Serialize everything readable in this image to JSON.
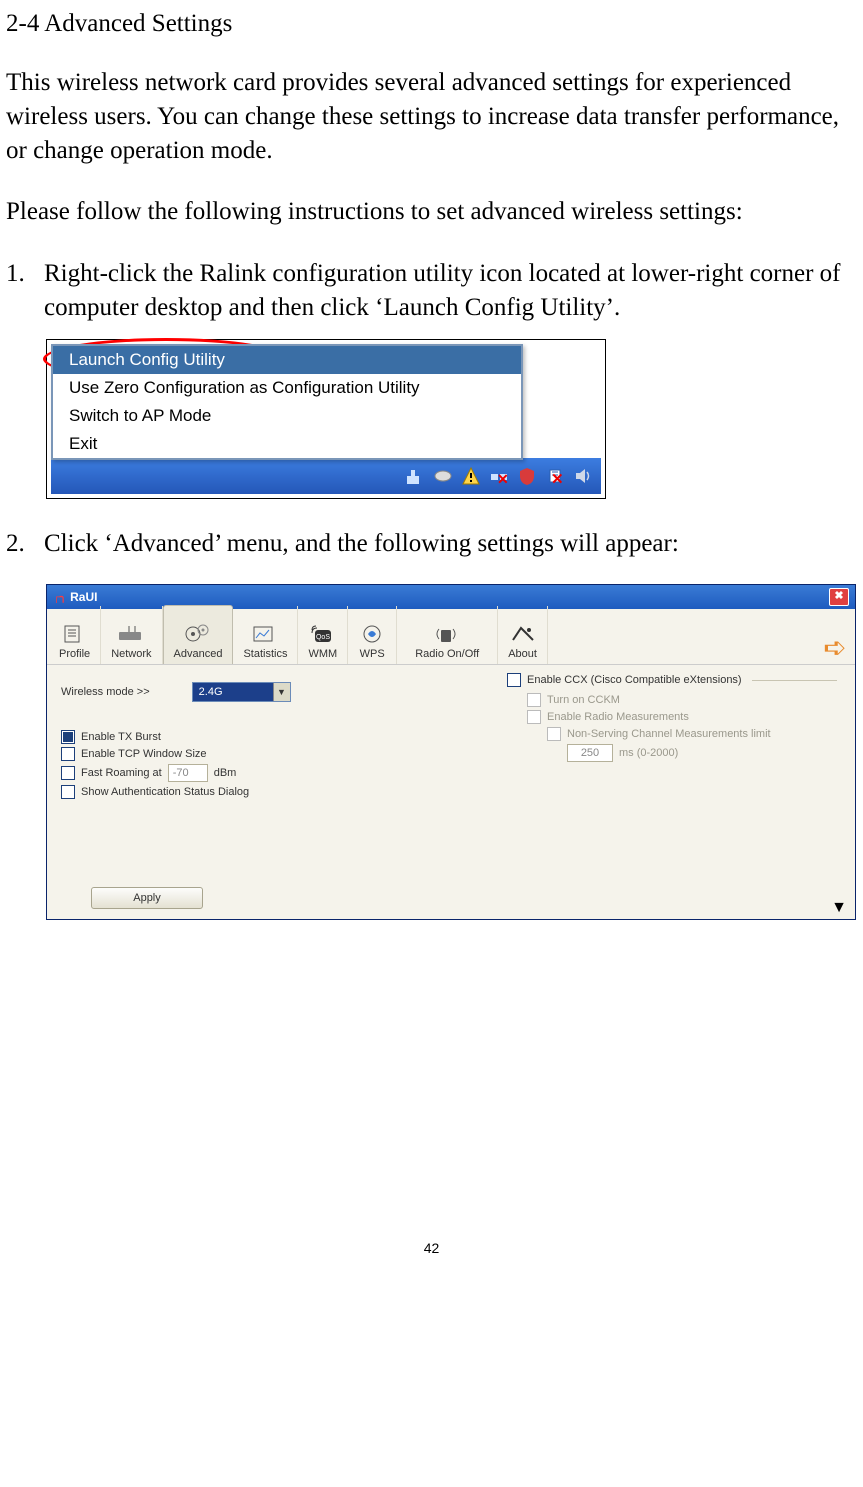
{
  "heading": "2-4 Advanced Settings",
  "para1": "This wireless network card provides several advanced settings for experienced wireless users. You can change these settings to increase data transfer performance, or change operation mode.",
  "para2": "Please follow the following instructions to set advanced wireless settings:",
  "steps": {
    "s1_num": "1.",
    "s1_text": "Right-click the Ralink configuration utility icon located at lower-right corner of computer desktop and then click ‘Launch Config Utility’.",
    "s2_num": "2.",
    "s2_text": "Click ‘Advanced’ menu, and the following settings will appear:"
  },
  "context_menu": {
    "items": [
      "Launch Config Utility",
      "Use Zero Configuration as Configuration Utility",
      "Switch to AP Mode",
      "Exit"
    ]
  },
  "raui": {
    "title": "RaUI",
    "close_glyph": "✖",
    "tabs": [
      "Profile",
      "Network",
      "Advanced",
      "Statistics",
      "WMM",
      "WPS",
      "Radio On/Off",
      "About"
    ],
    "wireless_mode_label": "Wireless mode >>",
    "wireless_mode_value": "2.4G",
    "left_checks": [
      {
        "label": "Enable TX Burst",
        "checked": true
      },
      {
        "label": "Enable TCP Window Size",
        "checked": false
      },
      {
        "label": "Fast Roaming at",
        "checked": false
      },
      {
        "label": "Show Authentication Status Dialog",
        "checked": false
      }
    ],
    "fast_roaming_value": "-70",
    "fast_roaming_unit": "dBm",
    "ccx_header": "Enable CCX (Cisco Compatible eXtensions)",
    "ccx_subs": [
      "Turn on CCKM",
      "Enable Radio Measurements",
      "Non-Serving Channel Measurements limit"
    ],
    "ccx_ms_value": "250",
    "ccx_ms_unit": "ms (0-2000)",
    "apply": "Apply"
  },
  "page_number": "42"
}
